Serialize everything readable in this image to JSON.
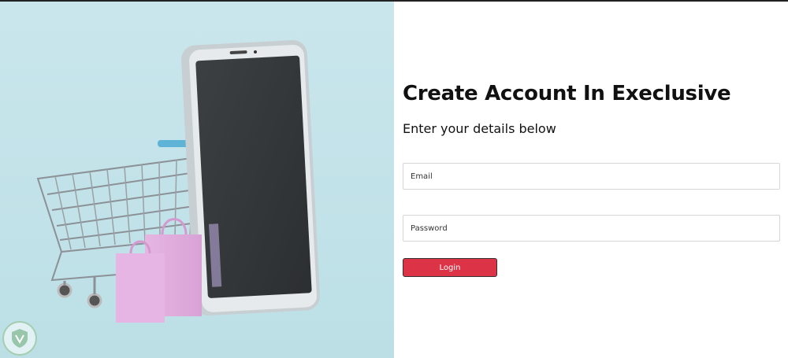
{
  "form": {
    "title": "Create Account In Execlusive",
    "subtitle": "Enter your details below",
    "email_placeholder": "Email",
    "password_placeholder": "Password",
    "login_label": "Login"
  },
  "colors": {
    "accent": "#dd3346",
    "hero_background": "#c6e4ea"
  },
  "icons": {
    "hero_image": "shopping-cart-with-phone-and-bags",
    "watermark": "shield-logo-icon"
  }
}
